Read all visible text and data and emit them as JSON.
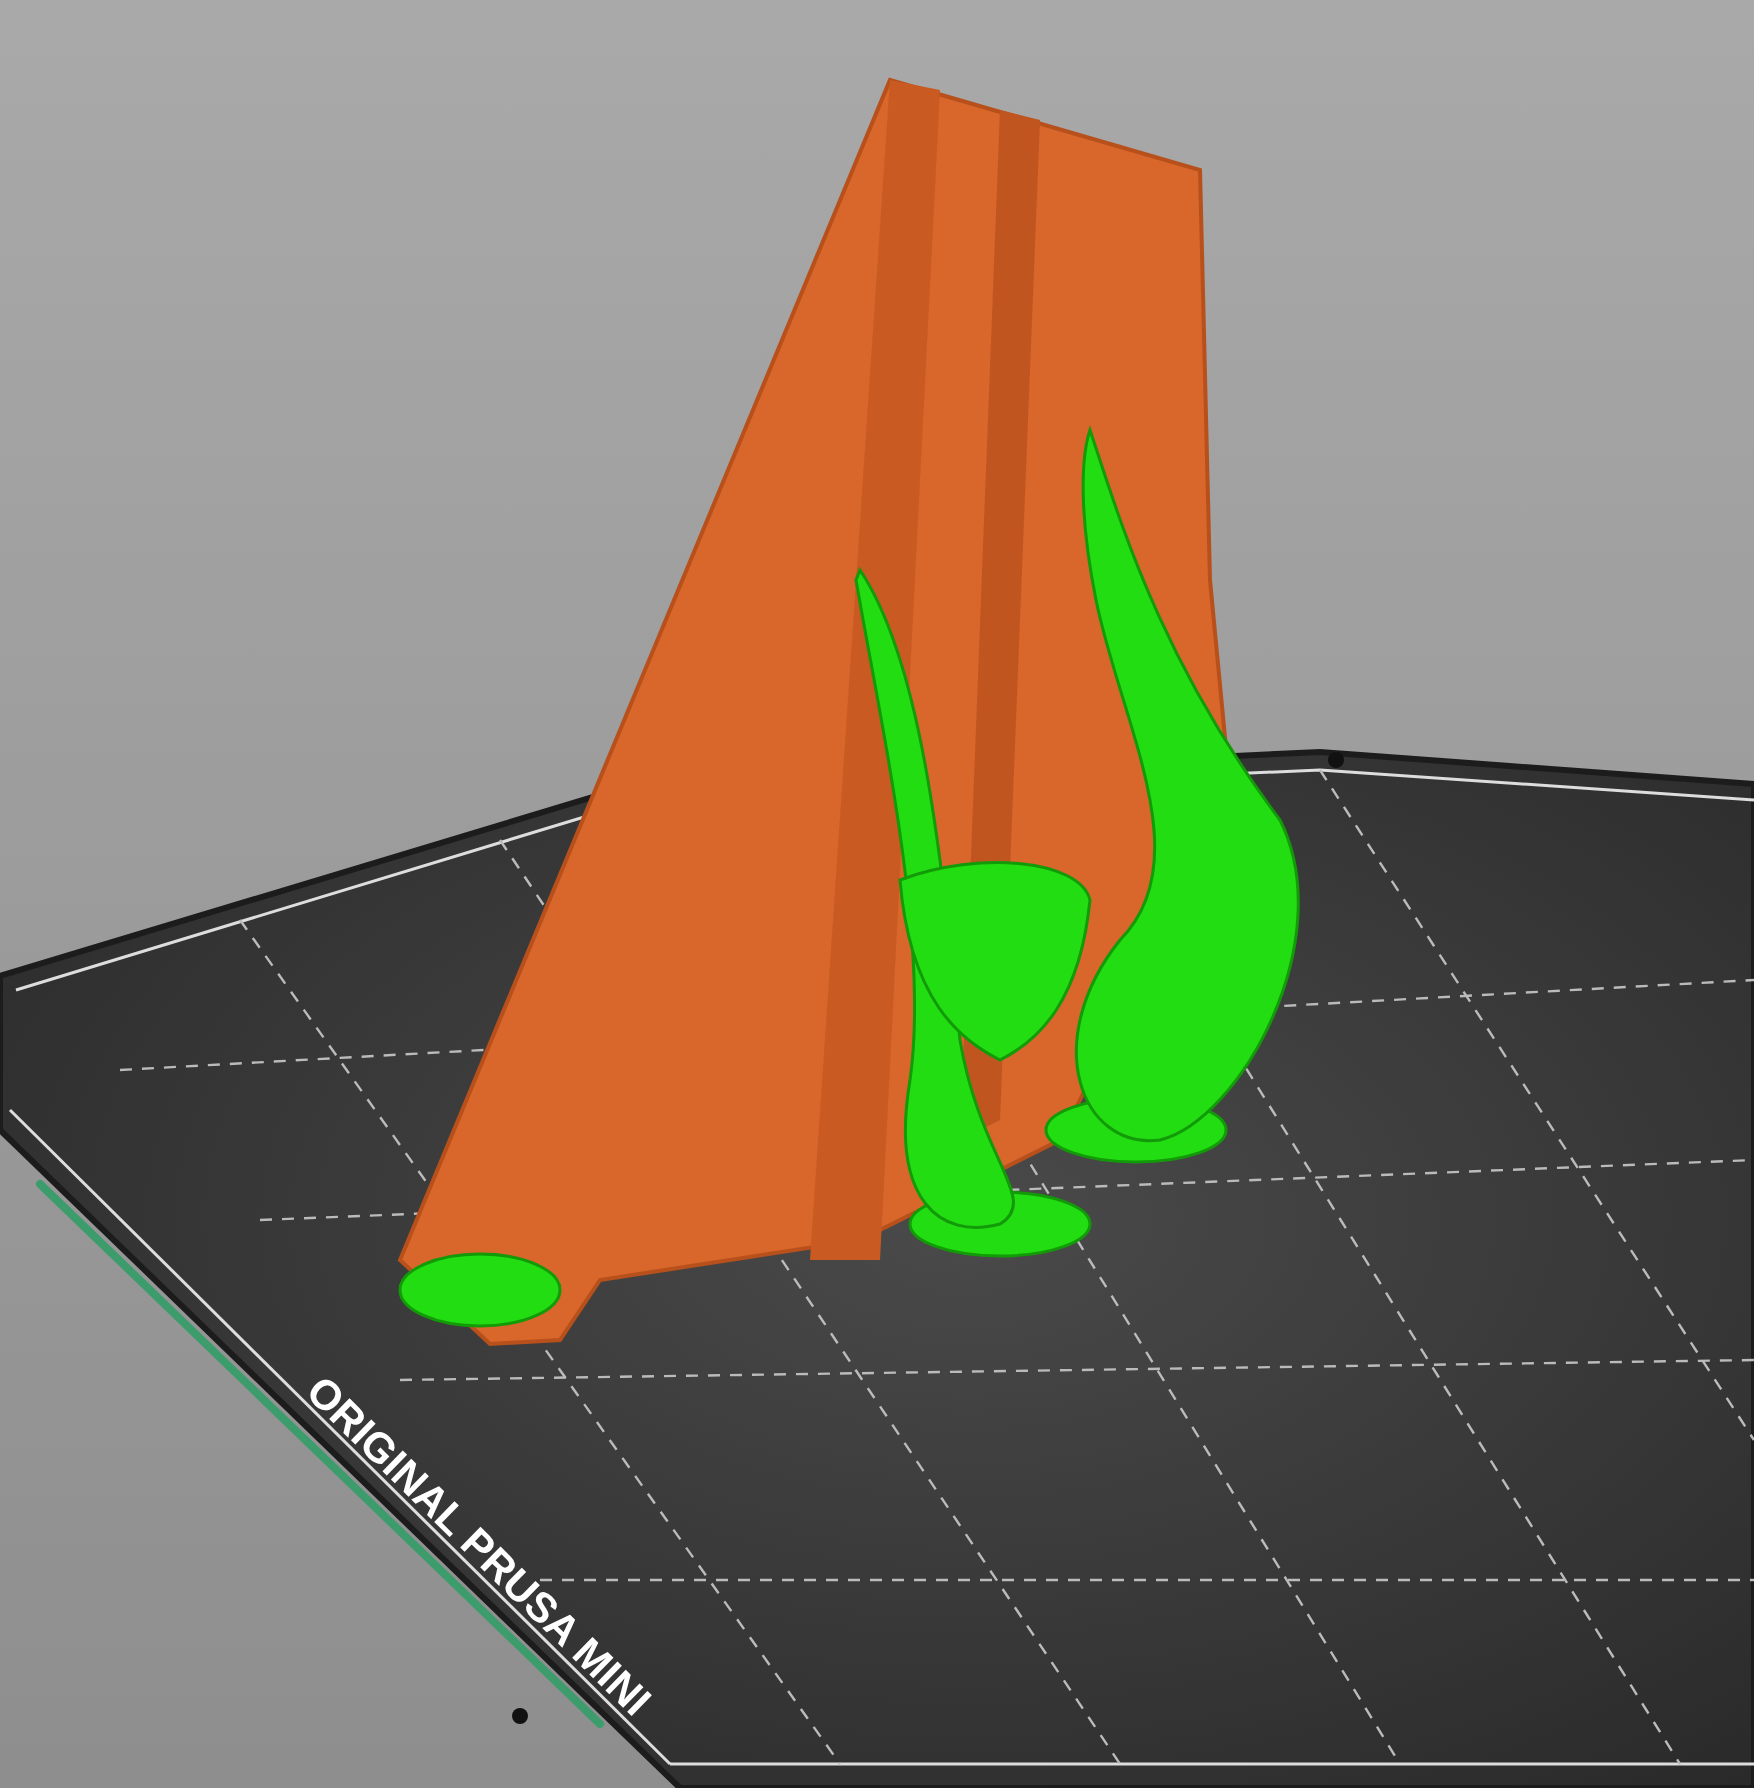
{
  "viewport": {
    "bed_label": "ORIGINAL PRUSA MINI"
  }
}
